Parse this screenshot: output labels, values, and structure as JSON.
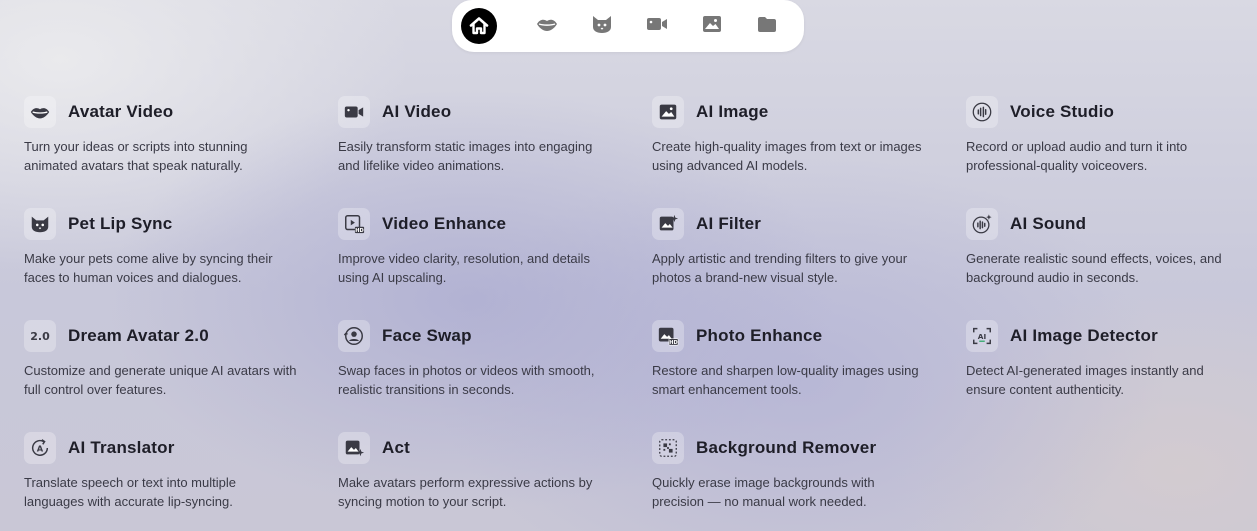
{
  "nav": [
    {
      "icon": "home-icon"
    },
    {
      "icon": "lips-icon"
    },
    {
      "icon": "cat-icon"
    },
    {
      "icon": "video-camera-icon"
    },
    {
      "icon": "image-icon"
    },
    {
      "icon": "folder-icon"
    }
  ],
  "features": [
    {
      "title": "Avatar Video",
      "desc": "Turn your ideas or scripts into stunning animated avatars that speak naturally.",
      "icon": "lips-icon"
    },
    {
      "title": "AI Video",
      "desc": "Easily transform static images into engaging and lifelike video animations.",
      "icon": "video-camera-icon"
    },
    {
      "title": "AI Image",
      "desc": "Create high-quality images from text or images using advanced AI models.",
      "icon": "image-icon"
    },
    {
      "title": "Voice Studio",
      "desc": "Record or upload audio and turn it into professional-quality voiceovers.",
      "icon": "sound-wave-icon"
    },
    {
      "title": "Pet Lip Sync",
      "desc": "Make your pets come alive by syncing their faces to human voices and dialogues.",
      "icon": "cat-icon"
    },
    {
      "title": "Video Enhance",
      "desc": "Improve video clarity, resolution, and details using AI upscaling.",
      "icon": "video-hd-icon"
    },
    {
      "title": "AI Filter",
      "desc": "Apply artistic and trending filters to give your photos a brand-new visual style.",
      "icon": "filter-sparkle-icon"
    },
    {
      "title": "AI Sound",
      "desc": "Generate realistic sound effects, voices, and background audio in seconds.",
      "icon": "sound-sparkle-icon"
    },
    {
      "title": "Dream Avatar 2.0",
      "desc": "Customize and generate unique AI avatars with full control over features.",
      "icon": "version-badge-icon",
      "badge": "2.0"
    },
    {
      "title": "Face Swap",
      "desc": "Swap faces in photos or videos with smooth, realistic transitions in seconds.",
      "icon": "face-swap-icon"
    },
    {
      "title": "Photo Enhance",
      "desc": "Restore and sharpen low-quality images using smart enhancement tools.",
      "icon": "image-hd-icon"
    },
    {
      "title": "AI Image Detector",
      "desc": "Detect AI-generated images instantly and ensure content authenticity.",
      "icon": "ai-detect-icon",
      "badge": "AI"
    },
    {
      "title": "AI Translator",
      "desc": "Translate speech or text into multiple languages with accurate lip-syncing.",
      "icon": "translate-icon",
      "badge": "A"
    },
    {
      "title": "Act",
      "desc": "Make avatars perform expressive actions by syncing motion to your script.",
      "icon": "act-icon"
    },
    {
      "title": "Background Remover",
      "desc": "Quickly erase image backgrounds with precision — no manual work needed.",
      "icon": "background-remove-icon"
    }
  ]
}
